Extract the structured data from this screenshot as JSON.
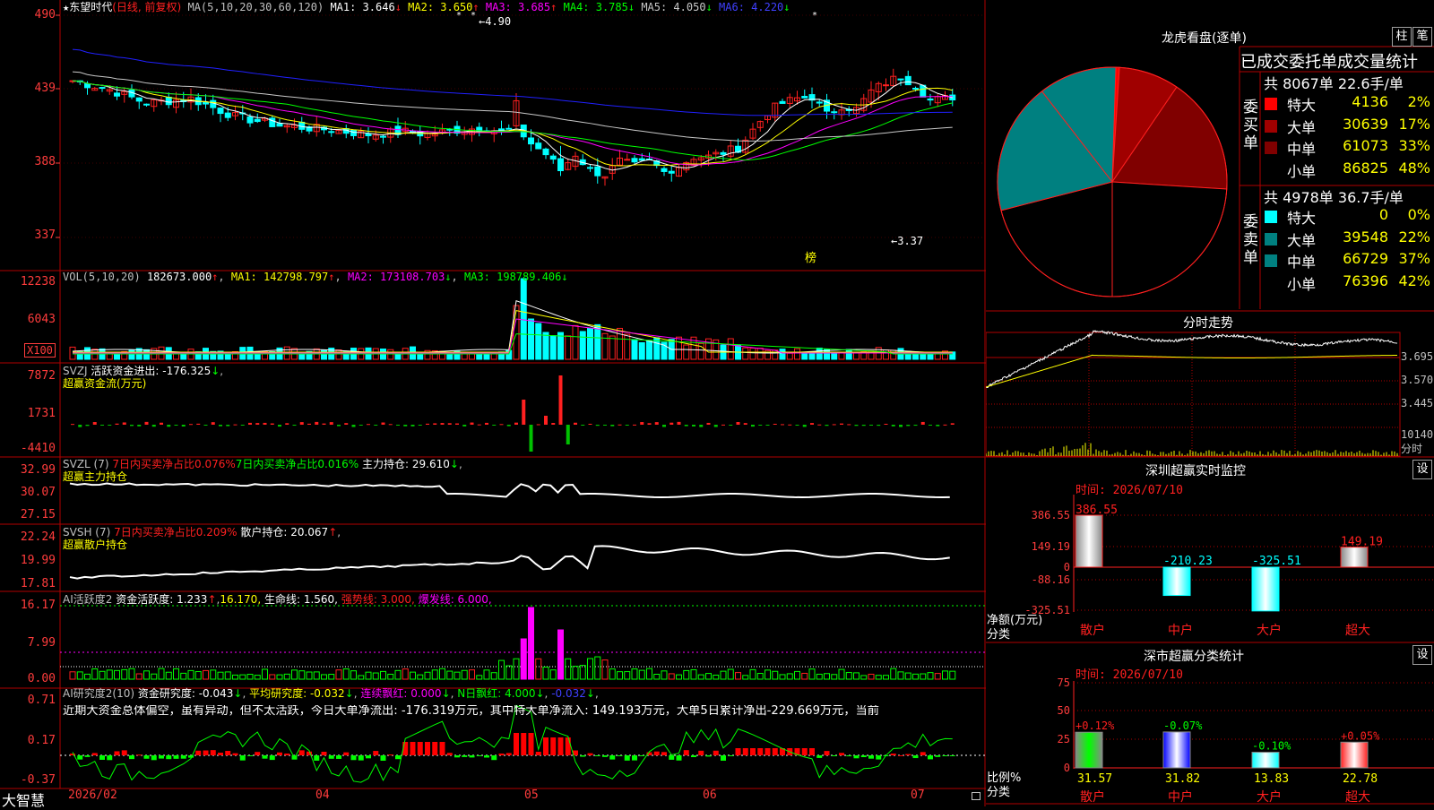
{
  "colors": {
    "up": "#ff2020",
    "down": "#00ffff",
    "ma1": "#ffffff",
    "ma2": "#ffff00",
    "ma3": "#ff00ff",
    "ma4": "#00ff00",
    "ma5": "#c8c8c8",
    "ma6": "#2020ff",
    "grid": "#8b0000",
    "pane_border": "#b00000"
  },
  "price_pane": {
    "title": "东望时代",
    "mode": "(日线, 前复权)",
    "ma_label": "MA(5,10,20,30,60,120)",
    "ma1": "MA1: 3.646",
    "ma2": "MA2: 3.650",
    "ma3": "MA3: 3.685",
    "ma4": "MA4: 3.785",
    "ma5": "MA5: 4.050",
    "ma6": "MA6: 4.220",
    "y_labels": [
      "490",
      "439",
      "388",
      "337"
    ],
    "high_mark": "4.90",
    "low_mark": "3.37",
    "rank_mark": "榜"
  },
  "vol_pane": {
    "label": "VOL(5,10,20)",
    "value": "182673.000",
    "ma1": "MA1: 142798.797",
    "ma2": "MA2: 173108.703",
    "ma3": "MA3: 198789.406",
    "y_labels": [
      "12238",
      "6043"
    ],
    "unit": "X100"
  },
  "svzj_pane": {
    "label": "SVZJ",
    "desc": "活跃资金进出: -176.325",
    "subtitle": "超赢资金流(万元)",
    "y_labels": [
      "7872",
      "1731",
      "-4410"
    ]
  },
  "svzl_pane": {
    "label": "SVZL (7)",
    "t1": "7日内买卖净占比0.076%",
    "t2": "7日内买卖净占比0.016%",
    "t3": "主力持仓: 29.610",
    "subtitle": "超赢主力持仓",
    "y_labels": [
      "32.99",
      "30.07",
      "27.15"
    ]
  },
  "svsh_pane": {
    "label": "SVSH (7)",
    "t1": "7日内买卖净占比0.209%",
    "t2": "散户持仓: 20.067",
    "subtitle": "超赢散户持仓",
    "y_labels": [
      "22.24",
      "19.99",
      "17.81"
    ]
  },
  "ai1_pane": {
    "label": "AI活跃度2",
    "t1": "资金活跃度: 1.233",
    "t2": "16.170,",
    "t3": "生命线: 1.560,",
    "t4": "强势线: 3.000,",
    "t5": "爆发线: 6.000,",
    "y_labels": [
      "16.17",
      "7.99",
      "0.00"
    ]
  },
  "ai2_pane": {
    "label": "AI研究度2(10)",
    "t1": "资金研究度: -0.043",
    "t2": "平均研究度: -0.032",
    "t3": "连续飘红: 0.000",
    "t4": "N日飘红: 4.000",
    "t5": "-0.032",
    "comment": "近期大资金总体偏空，虽有异动，但不太活跃，今日大单净流出: -176.319万元，其中特大单净流入: 149.193万元，大单5日累计净出-229.669万元，当前",
    "y_labels": [
      "0.71",
      "0.17",
      "-0.37"
    ]
  },
  "x_axis": {
    "labels": [
      "2026/02",
      "04",
      "05",
      "06",
      "07"
    ]
  },
  "brand": "大智慧",
  "lhb": {
    "title": "龙虎看盘(逐单)",
    "btn_bar": "柱",
    "btn_pen": "笔",
    "stat_title": "已成交委托单成交量统计",
    "buy_label": "委买单",
    "sell_label": "委卖单",
    "buy_total": "共 8067单 22.6手/单",
    "sell_total": "共 4978单 36.7手/单",
    "buy_rows": [
      {
        "name": "特大",
        "vol": "4136",
        "pct": "2%",
        "color": "#ff0000"
      },
      {
        "name": "大单",
        "vol": "30639",
        "pct": "17%",
        "color": "#a00000"
      },
      {
        "name": "中单",
        "vol": "61073",
        "pct": "33%",
        "color": "#800000"
      },
      {
        "name": "小单",
        "vol": "86825",
        "pct": "48%",
        "color": ""
      }
    ],
    "sell_rows": [
      {
        "name": "特大",
        "vol": "0",
        "pct": "0%",
        "color": "#00ffff"
      },
      {
        "name": "大单",
        "vol": "39548",
        "pct": "22%",
        "color": "#008080"
      },
      {
        "name": "中单",
        "vol": "66729",
        "pct": "37%",
        "color": "#008080"
      },
      {
        "name": "小单",
        "vol": "76396",
        "pct": "42%",
        "color": ""
      }
    ],
    "pie_slices": [
      {
        "pct": 2,
        "color": "#ff0000"
      },
      {
        "pct": 17,
        "color": "#a00000"
      },
      {
        "pct": 33,
        "color": "#800000"
      },
      {
        "pct": 48,
        "color": "#000000"
      },
      {
        "pct": 42,
        "color": "#000000"
      },
      {
        "pct": 37,
        "color": "#008080"
      },
      {
        "pct": 22,
        "color": "#008080"
      },
      {
        "pct": 0,
        "color": "#00ffff"
      }
    ]
  },
  "intraday": {
    "title": "分时走势",
    "y_labels": [
      "3.695",
      "3.570",
      "3.445"
    ],
    "vol_labels": [
      "10140",
      "分时"
    ]
  },
  "sz_monitor": {
    "title": "深圳超赢实时监控",
    "btn": "设",
    "time": "时间: 2026/07/10",
    "y_labels": [
      "386.55",
      "149.19",
      "0",
      "-88.16",
      "-325.51"
    ],
    "unit": "净额(万元)",
    "unit2": "分类",
    "categories": [
      "散户",
      "中户",
      "大户",
      "超大"
    ],
    "values": [
      386.55,
      -210.23,
      -325.51,
      149.19
    ],
    "value_labels": [
      "386.55",
      "-210.23",
      "-325.51",
      "149.19"
    ]
  },
  "sz_class": {
    "title": "深市超赢分类统计",
    "btn": "设",
    "time": "时间: 2026/07/10",
    "y_labels": [
      "75",
      "50",
      "25",
      "0"
    ],
    "unit": "比例%",
    "unit2": "分类",
    "categories": [
      "散户",
      "中户",
      "大户",
      "超大"
    ],
    "values": [
      31.57,
      31.82,
      13.83,
      22.78
    ],
    "changes": [
      "+0.12%",
      "-0.07%",
      "-0.10%",
      "+0.05%"
    ],
    "value_labels": [
      "31.57",
      "31.82",
      "13.83",
      "22.78"
    ]
  }
}
